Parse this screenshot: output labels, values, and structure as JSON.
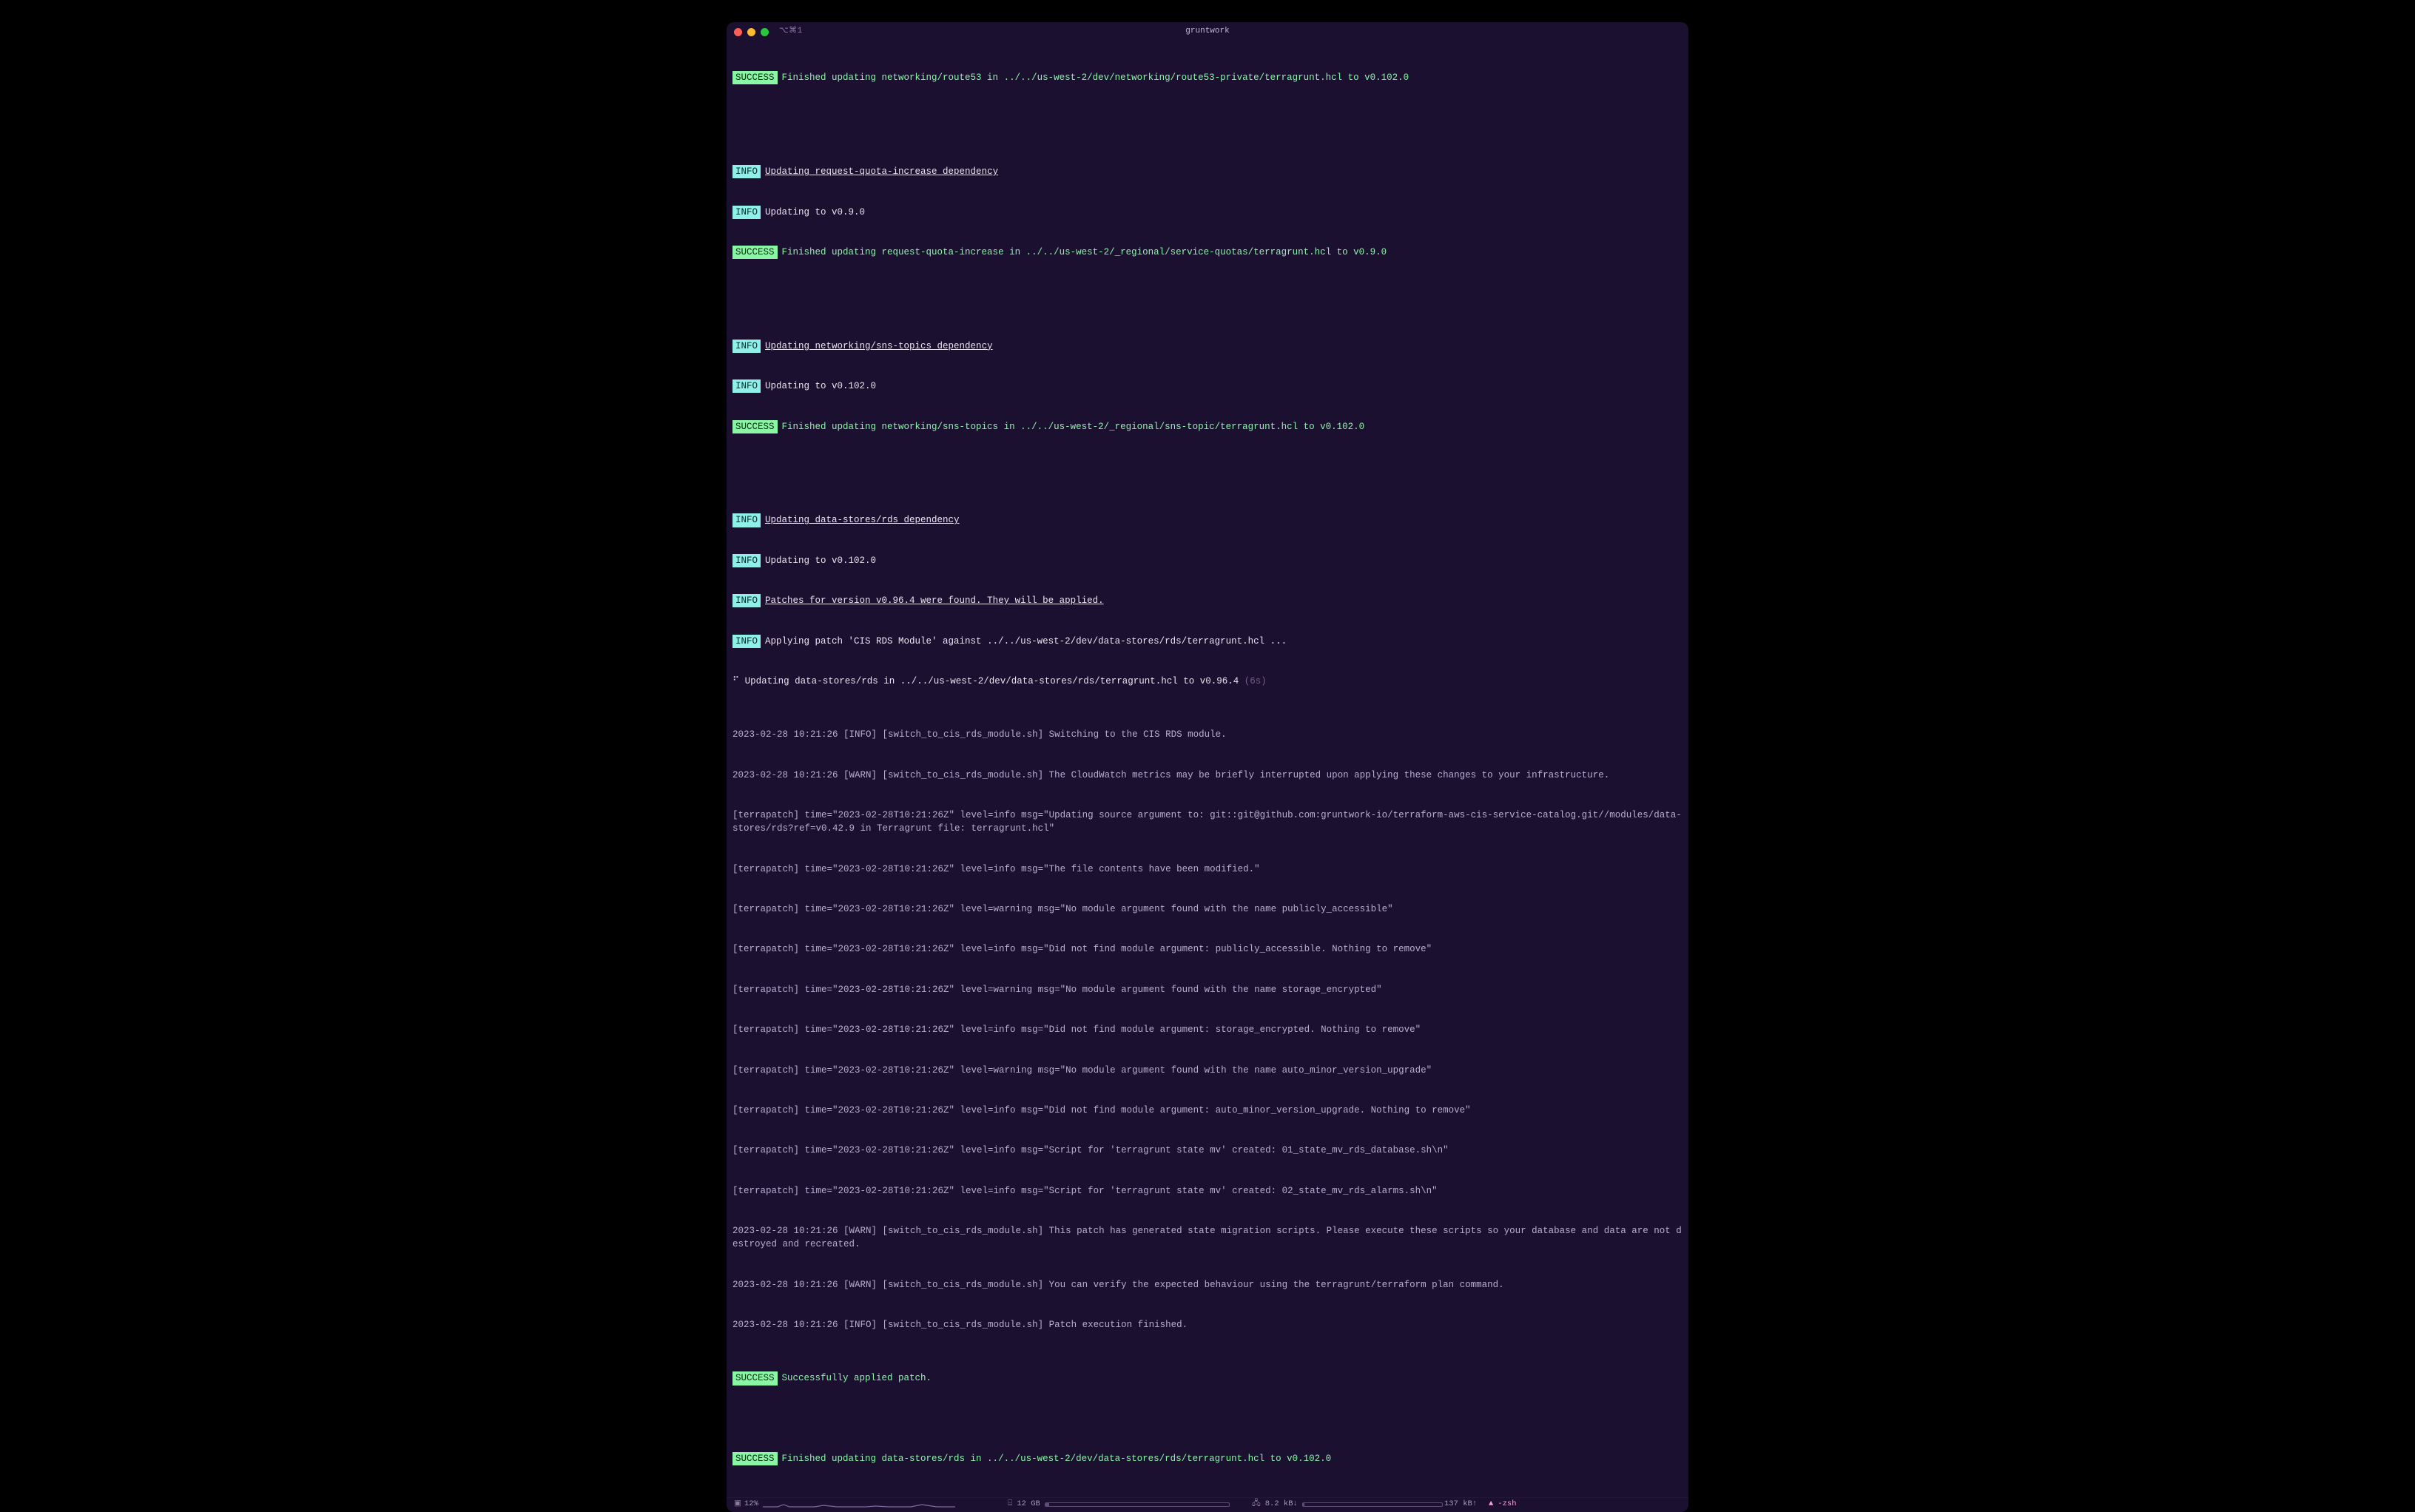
{
  "window": {
    "tab_label": "⌥⌘1",
    "title": "gruntwork"
  },
  "badges": {
    "success": "SUCCESS",
    "info": "INFO"
  },
  "lines": {
    "l1": "Finished updating networking/route53 in ../../us-west-2/dev/networking/route53-private/terragrunt.hcl to v0.102.0",
    "l2": "Updating request-quota-increase dependency",
    "l3": "Updating to v0.9.0",
    "l4": "Finished updating request-quota-increase in ../../us-west-2/_regional/service-quotas/terragrunt.hcl to v0.9.0",
    "l5": "Updating networking/sns-topics dependency",
    "l6": "Updating to v0.102.0",
    "l7": "Finished updating networking/sns-topics in ../../us-west-2/_regional/sns-topic/terragrunt.hcl to v0.102.0",
    "l8": "Updating data-stores/rds dependency",
    "l9": "Updating to v0.102.0",
    "l10": "Patches for version v0.96.4 were found. They will be applied.",
    "l11": "Applying patch 'CIS RDS Module' against ../../us-west-2/dev/data-stores/rds/terragrunt.hcl ...",
    "l12_pre": "Updating data-stores/rds in ../../us-west-2/dev/data-stores/rds/terragrunt.hcl to v0.96.4 ",
    "l12_dim": "(6s)",
    "log1": "2023-02-28 10:21:26 [INFO] [switch_to_cis_rds_module.sh] Switching to the CIS RDS module.",
    "log2": "2023-02-28 10:21:26 [WARN] [switch_to_cis_rds_module.sh] The CloudWatch metrics may be briefly interrupted upon applying these changes to your infrastructure.",
    "log3": "[terrapatch] time=\"2023-02-28T10:21:26Z\" level=info msg=\"Updating source argument to: git::git@github.com:gruntwork-io/terraform-aws-cis-service-catalog.git//modules/data-stores/rds?ref=v0.42.9 in Terragrunt file: terragrunt.hcl\"",
    "log4": "[terrapatch] time=\"2023-02-28T10:21:26Z\" level=info msg=\"The file contents have been modified.\"",
    "log5": "[terrapatch] time=\"2023-02-28T10:21:26Z\" level=warning msg=\"No module argument found with the name publicly_accessible\"",
    "log6": "[terrapatch] time=\"2023-02-28T10:21:26Z\" level=info msg=\"Did not find module argument: publicly_accessible. Nothing to remove\"",
    "log7": "[terrapatch] time=\"2023-02-28T10:21:26Z\" level=warning msg=\"No module argument found with the name storage_encrypted\"",
    "log8": "[terrapatch] time=\"2023-02-28T10:21:26Z\" level=info msg=\"Did not find module argument: storage_encrypted. Nothing to remove\"",
    "log9": "[terrapatch] time=\"2023-02-28T10:21:26Z\" level=warning msg=\"No module argument found with the name auto_minor_version_upgrade\"",
    "log10": "[terrapatch] time=\"2023-02-28T10:21:26Z\" level=info msg=\"Did not find module argument: auto_minor_version_upgrade. Nothing to remove\"",
    "log11": "[terrapatch] time=\"2023-02-28T10:21:26Z\" level=info msg=\"Script for 'terragrunt state mv' created: 01_state_mv_rds_database.sh\\n\"",
    "log12": "[terrapatch] time=\"2023-02-28T10:21:26Z\" level=info msg=\"Script for 'terragrunt state mv' created: 02_state_mv_rds_alarms.sh\\n\"",
    "log13": "2023-02-28 10:21:26 [WARN] [switch_to_cis_rds_module.sh] This patch has generated state migration scripts. Please execute these scripts so your database and data are not destroyed and recreated.",
    "log14": "2023-02-28 10:21:26 [WARN] [switch_to_cis_rds_module.sh] You can verify the expected behaviour using the terragrunt/terraform plan command.",
    "log15": "2023-02-28 10:21:26 [INFO] [switch_to_cis_rds_module.sh] Patch execution finished.",
    "l13": "Successfully applied patch.",
    "l14": "Finished updating data-stores/rds in ../../us-west-2/dev/data-stores/rds/terragrunt.hcl to v0.102.0"
  },
  "status": {
    "cpu_glyph": "▣",
    "cpu_pct": "12%",
    "mem_glyph": "⌸",
    "mem_text": "12 GB",
    "net_glyph": "🖧",
    "net_down": "8.2 kB↓",
    "net_up": "137 kB↑",
    "shell_glyph": "▲",
    "shell": "-zsh"
  }
}
